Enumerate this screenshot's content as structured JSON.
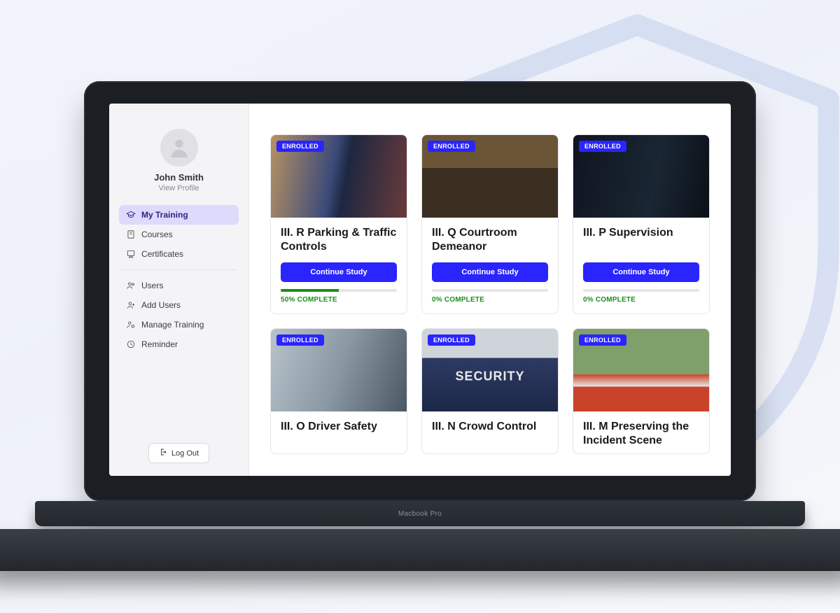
{
  "brand": "Macbook Pro",
  "user": {
    "name": "John Smith",
    "view_profile": "View Profile"
  },
  "sidebar": {
    "items": [
      {
        "label": "My Training",
        "active": true
      },
      {
        "label": "Courses"
      },
      {
        "label": "Certificates"
      },
      {
        "label": "Users"
      },
      {
        "label": "Add Users"
      },
      {
        "label": "Manage Training"
      },
      {
        "label": "Reminder"
      }
    ],
    "logout": "Log Out"
  },
  "badge_label": "ENROLLED",
  "cta_label": "Continue Study",
  "courses": [
    {
      "title": "III. R Parking & Traffic Controls",
      "progress": 50,
      "progress_text": "50% COMPLETE"
    },
    {
      "title": "III. Q Courtroom Demeanor",
      "progress": 0,
      "progress_text": "0% COMPLETE"
    },
    {
      "title": "III. P Supervision",
      "progress": 0,
      "progress_text": "0% COMPLETE"
    },
    {
      "title": "III. O Driver Safety"
    },
    {
      "title": "III. N Crowd Control"
    },
    {
      "title": "III. M Preserving the Incident Scene"
    }
  ]
}
